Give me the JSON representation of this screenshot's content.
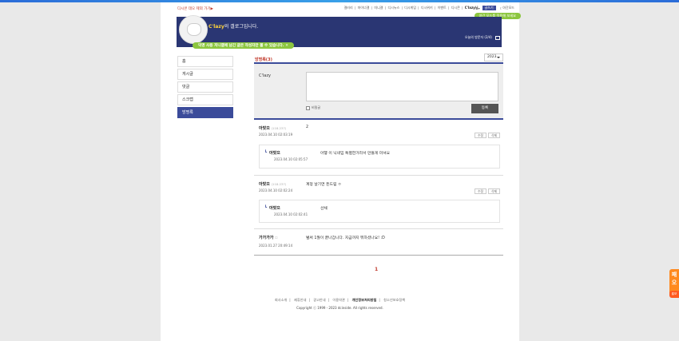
{
  "header": {
    "gallery_link": "디시콘 데오 제외 가기▶",
    "gnb": [
      "갤러리",
      "마이너갤",
      "미니갤",
      "디시뉴스",
      "디시게임",
      "디시위키",
      "이벤트",
      "디시콘"
    ],
    "user": "C'lazy님",
    "write_button": "글쓰기",
    "dark_mode": "야간모드",
    "tooltip": "야간 모드를 적용해 보세요"
  },
  "banner": {
    "owner": "C'lazy",
    "title_suffix": "의 갤로그입니다.",
    "visitors": "오늘의 방문자 (2/4)",
    "notice": "익명 사용 저니갤에 남긴 글은 작성자만 볼 수 있습니다."
  },
  "sidebar": {
    "items": [
      {
        "label": "홈",
        "active": false
      },
      {
        "label": "게시글",
        "active": false
      },
      {
        "label": "댓글",
        "active": false
      },
      {
        "label": "스크랩",
        "active": false
      },
      {
        "label": "방명록",
        "active": true
      }
    ]
  },
  "guestbook": {
    "title": "방명록(3)",
    "year": "2023",
    "write": {
      "nick": "C'lazy",
      "secret_label": "비밀글",
      "submit_label": "등록"
    },
    "entries": [
      {
        "nick": "아맞으",
        "ip": "(118.237)",
        "date": "2023.04.10 02:03:19",
        "text": "2",
        "edit": "수정",
        "delete": "삭제",
        "reply": {
          "nick": "아맞으",
          "date": "2023.04.10 02:05:57",
          "text": "아햏 이 닉네임 특별한거라서 만들게 마셔요"
        }
      },
      {
        "nick": "아맞으",
        "ip": "(118.237)",
        "date": "2023.04.10 02:02:24",
        "text": "계정 날기면 돈드림 ㅇ",
        "edit": "수정",
        "delete": "삭제",
        "reply": {
          "nick": "아맞으",
          "date": "2023.04.10 02:02:41",
          "text": "선채"
        }
      },
      {
        "nick": "가가가가",
        "ip": "",
        "date": "2023.01.27 20:49:14",
        "text": "벌써 1월이 끝나갑니다. 지금까지 뭐하셨나요! :D"
      }
    ],
    "page": "1"
  },
  "footer": {
    "links": [
      "회사소개",
      "제휴안내",
      "광고안내",
      "이용약관",
      "개인정보처리방침",
      "청소년보호정책"
    ],
    "bold_index": 4,
    "copyright": "Copyright ⓒ 1999 - 2023 dcinside. All rights reserved."
  },
  "floater": {
    "text": "패오",
    "sub": "홍보"
  }
}
